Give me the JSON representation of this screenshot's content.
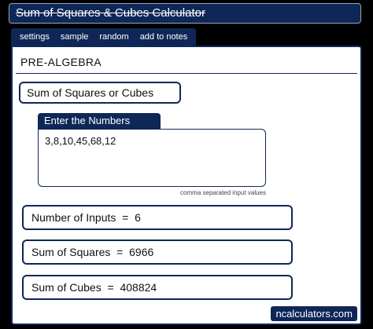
{
  "window": {
    "title": "Sum of Squares & Cubes Calculator"
  },
  "tabs": [
    {
      "label": "settings"
    },
    {
      "label": "sample"
    },
    {
      "label": "random"
    },
    {
      "label": "add to notes"
    }
  ],
  "panel": {
    "category": "PRE-ALGEBRA",
    "calculator_name": "Sum of Squares or Cubes"
  },
  "input": {
    "label": "Enter the Numbers",
    "value": "3,8,10,45,68,12",
    "hint": "comma separated input values"
  },
  "results": [
    {
      "label": "Number of Inputs",
      "eq": "=",
      "value": "6"
    },
    {
      "label": "Sum of Squares",
      "eq": "=",
      "value": "6966"
    },
    {
      "label": "Sum of Cubes",
      "eq": "=",
      "value": "408824"
    }
  ],
  "brand": "ncalculators.com"
}
